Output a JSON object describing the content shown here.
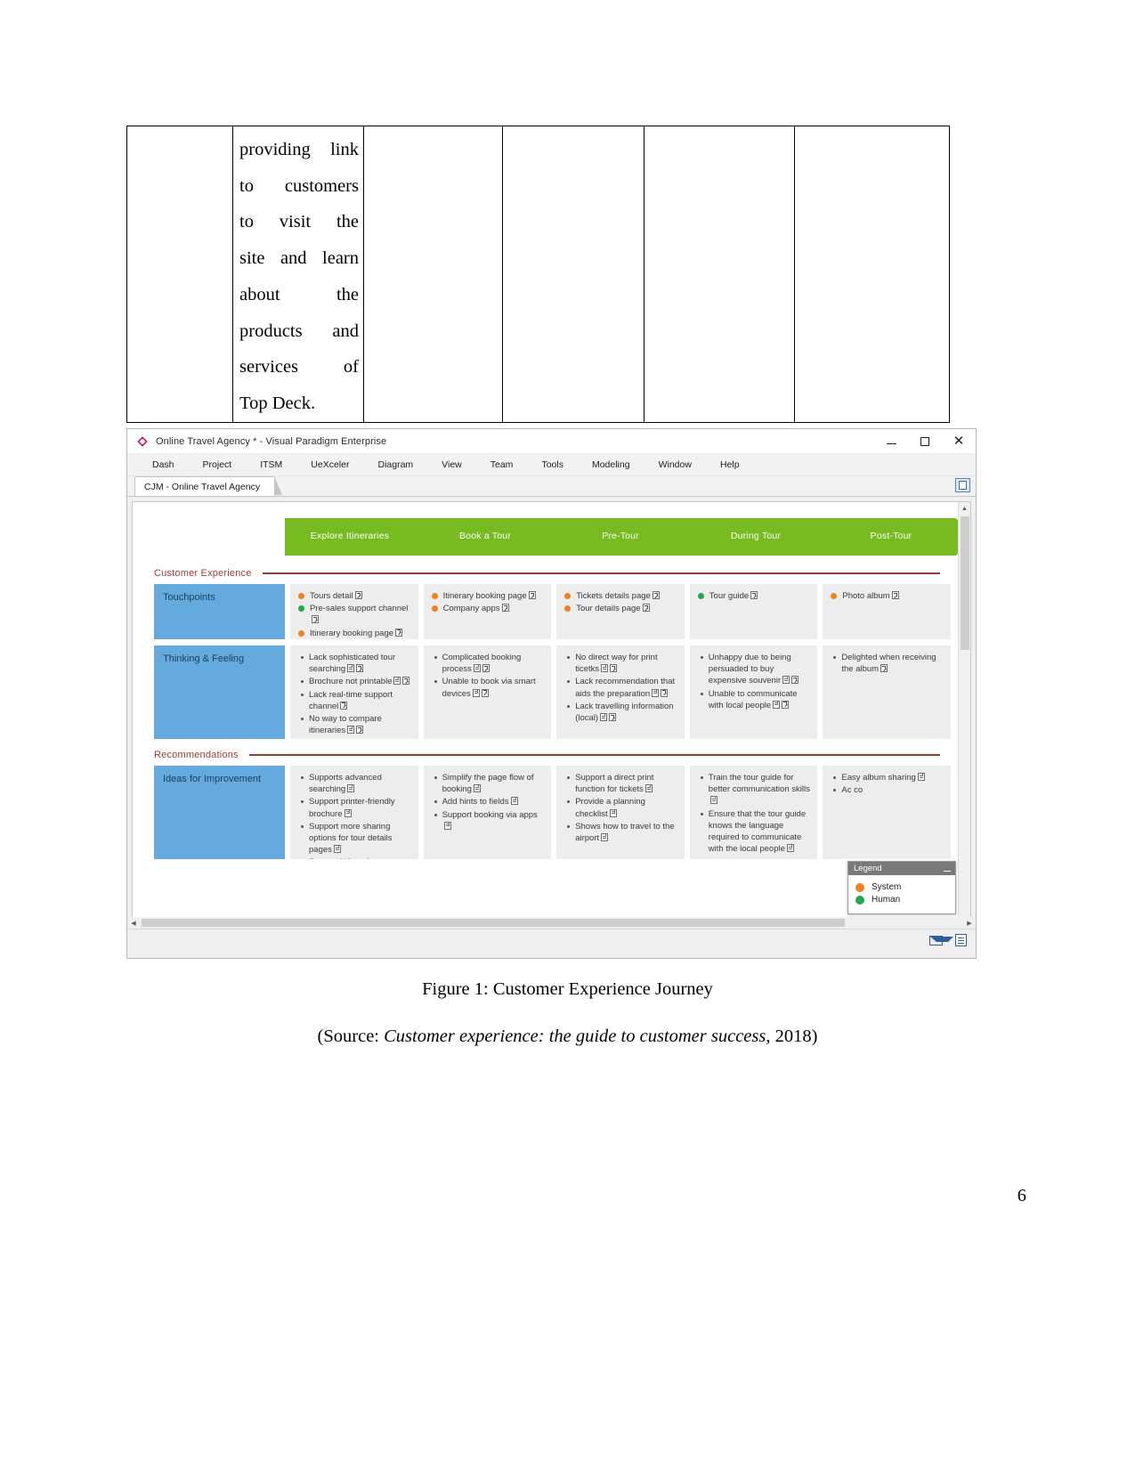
{
  "document": {
    "table": {
      "columns": 5,
      "cell_text_lines": [
        "providing  link",
        "to     customers",
        "to     visit     the",
        "site  and   learn",
        "about             the",
        "products        and",
        "services          of",
        "Top Deck."
      ]
    },
    "caption": "Figure 1: Customer Experience Journey",
    "source_prefix": "(Source: ",
    "source_italic": "Customer experience: the guide to customer success",
    "source_suffix": ", 2018)",
    "page_number": "6"
  },
  "app": {
    "window_title": "Online Travel Agency * - Visual Paradigm Enterprise",
    "logo_icon": "visual-paradigm-diamond-logo",
    "window_controls": {
      "minimize": "minimize-icon",
      "maximize": "maximize-icon",
      "close": "close-icon"
    },
    "menu": [
      "Dash",
      "Project",
      "ITSM",
      "UeXceler",
      "Diagram",
      "View",
      "Team",
      "Tools",
      "Modeling",
      "Window",
      "Help"
    ],
    "tab": {
      "label": "CJM - Online Travel Agency",
      "right_icon": "panel-toggle-icon"
    },
    "statusbar": {
      "mail_icon": "mail-icon",
      "note_icon": "note-icon"
    },
    "scrollbars": {
      "vertical_up": "▲",
      "vertical_down": "▼",
      "horizontal_left": "◀",
      "horizontal_right": "▶"
    }
  },
  "journey": {
    "stages": [
      "Explore Itineraries",
      "Book a Tour",
      "Pre-Tour",
      "During Tour",
      "Post-Tour"
    ],
    "stage_color": "#76bc21",
    "sections": [
      {
        "label": "Customer Experience",
        "color": "#a23b34"
      },
      {
        "label": "Recommendations",
        "color": "#a23b34"
      }
    ],
    "rows": [
      {
        "header": "Touchpoints",
        "type": "dots",
        "cells": [
          [
            {
              "text": "Tours detail",
              "kind": "system",
              "icons": [
                "arrow"
              ]
            },
            {
              "text": "Pre-sales support channel",
              "kind": "human",
              "icons": [
                "arrow"
              ]
            },
            {
              "text": "Itinerary booking page",
              "kind": "system",
              "icons": [
                "arrow"
              ]
            }
          ],
          [
            {
              "text": "Itinerary booking page",
              "kind": "system",
              "icons": [
                "arrow"
              ]
            },
            {
              "text": "Company apps",
              "kind": "system",
              "icons": [
                "arrow"
              ]
            }
          ],
          [
            {
              "text": "Tickets details page",
              "kind": "system",
              "icons": [
                "arrow"
              ]
            },
            {
              "text": "Tour details page",
              "kind": "system",
              "icons": [
                "arrow"
              ]
            }
          ],
          [
            {
              "text": "Tour guide",
              "kind": "human",
              "icons": [
                "arrow"
              ]
            }
          ],
          [
            {
              "text": "Photo album",
              "kind": "system",
              "icons": [
                "arrow"
              ]
            }
          ]
        ]
      },
      {
        "header": "Thinking & Feeling",
        "type": "bullets",
        "cells": [
          [
            {
              "text": "Lack sophisticated tour searching",
              "icons": [
                "doc",
                "arrow"
              ]
            },
            {
              "text": "Brochure not printable",
              "icons": [
                "doc",
                "arrow"
              ]
            },
            {
              "text": "Lack real-time support channel",
              "icons": [
                "arrow"
              ]
            },
            {
              "text": "No way to compare itineraries",
              "icons": [
                "doc",
                "arrow"
              ]
            }
          ],
          [
            {
              "text": "Complicated booking process",
              "icons": [
                "doc",
                "arrow"
              ]
            },
            {
              "text": "Unable to book via smart devices",
              "icons": [
                "doc",
                "arrow"
              ]
            }
          ],
          [
            {
              "text": "No direct way for print ticetks",
              "icons": [
                "doc",
                "arrow"
              ]
            },
            {
              "text": "Lack recommendation that aids the preparation",
              "icons": [
                "doc",
                "arrow"
              ]
            },
            {
              "text": "Lack travelling information (local)",
              "icons": [
                "doc",
                "arrow"
              ]
            }
          ],
          [
            {
              "text": "Unhappy due to being persuaded to buy expensive souvenir",
              "icons": [
                "doc",
                "arrow"
              ]
            },
            {
              "text": "Unable to communicate with local people",
              "icons": [
                "doc",
                "arrow"
              ]
            }
          ],
          [
            {
              "text": "Delighted when receiving the album",
              "icons": [
                "arrow"
              ]
            }
          ]
        ]
      },
      {
        "header": "Ideas for Improvement",
        "type": "bullets",
        "cells": [
          [
            {
              "text": "Supports advanced searching",
              "icons": [
                "doc"
              ]
            },
            {
              "text": "Support printer-friendly brochure",
              "icons": [
                "doc"
              ]
            },
            {
              "text": "Support more sharing options for tour details pages",
              "icons": [
                "doc"
              ]
            },
            {
              "text": "Support WhatsApp",
              "icons": []
            }
          ],
          [
            {
              "text": "Simplify the page flow of booking",
              "icons": [
                "doc"
              ]
            },
            {
              "text": "Add hints to fields",
              "icons": [
                "doc"
              ]
            },
            {
              "text": "Support booking via apps",
              "icons": [
                "doc"
              ]
            }
          ],
          [
            {
              "text": "Support a direct print function for tickets",
              "icons": [
                "doc"
              ]
            },
            {
              "text": "Provide a planning checklist",
              "icons": [
                "doc"
              ]
            },
            {
              "text": "Shows how to travel to the airport",
              "icons": [
                "doc"
              ]
            }
          ],
          [
            {
              "text": "Train the tour guide for better communication skills",
              "icons": [
                "doc"
              ]
            },
            {
              "text": "Ensure that the tour guide knows the language required to communicate with the local people",
              "icons": [
                "doc"
              ]
            }
          ],
          [
            {
              "text": "Easy album sharing",
              "icons": [
                "doc"
              ]
            },
            {
              "text": "Ac  co",
              "icons": []
            }
          ]
        ]
      }
    ],
    "legend": {
      "title": "Legend",
      "minimize_icon": "minimize-icon",
      "items": [
        {
          "label": "System",
          "color": "#f0821e"
        },
        {
          "label": "Human",
          "color": "#1faa4b"
        }
      ]
    }
  }
}
